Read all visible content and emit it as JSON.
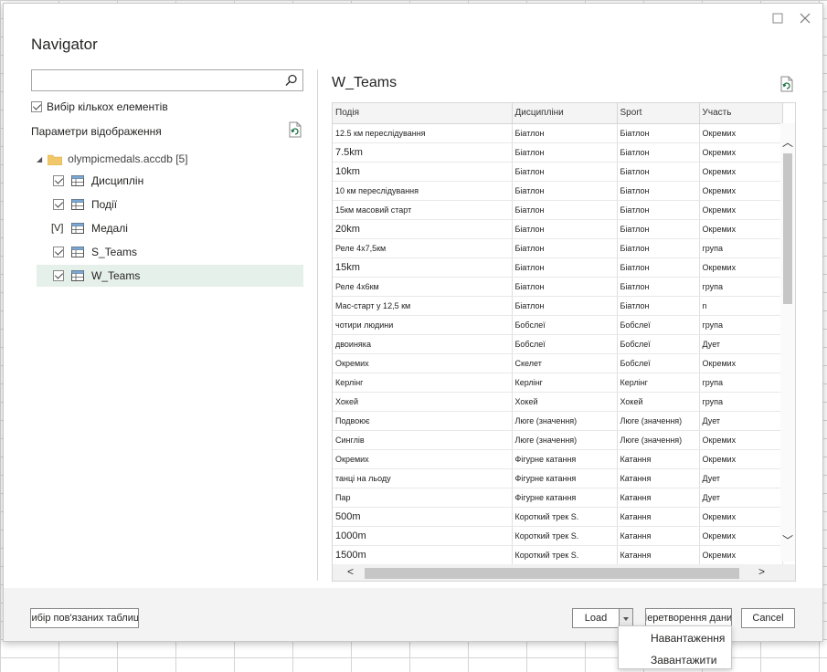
{
  "dialog": {
    "title": "Navigator",
    "window_controls": {
      "maximize_icon": "maximize-icon",
      "close_icon": "close-icon"
    }
  },
  "left_pane": {
    "search": {
      "placeholder": "",
      "value": ""
    },
    "multi_select_label": "Вибір кількох елементів",
    "multi_select_checked": true,
    "display_options_label": "Параметри відображення",
    "tree": {
      "root_label": "olympicmedals.accdb [5]",
      "items": [
        {
          "label": "Дисциплін",
          "checked": true,
          "selected": false
        },
        {
          "label": "Події",
          "checked": true,
          "selected": false
        },
        {
          "label": "Медалі",
          "checked": false,
          "partial_marker": "[V]",
          "selected": false
        },
        {
          "label": "S_Teams",
          "checked": true,
          "selected": false
        },
        {
          "label": "W_Teams",
          "checked": true,
          "selected": true
        }
      ]
    }
  },
  "preview": {
    "title": "W_Teams",
    "columns": [
      "Подія",
      "Дисципліни",
      "Sport",
      "Участь"
    ],
    "rows": [
      [
        "12.5 км переслідування",
        "Біатлон",
        "Біатлон",
        "Окремих"
      ],
      [
        "7.5km",
        "Біатлон",
        "Біатлон",
        "Окремих"
      ],
      [
        "10km",
        "Біатлон",
        "Біатлон",
        "Окремих"
      ],
      [
        "10 км переслідування",
        "Біатлон",
        "Біатлон",
        "Окремих"
      ],
      [
        "15км масовий старт",
        "Біатлон",
        "Біатлон",
        "Окремих"
      ],
      [
        "20km",
        "Біатлон",
        "Біатлон",
        "Окремих"
      ],
      [
        "Реле 4x7,5км",
        "Біатлон",
        "Біатлон",
        "група"
      ],
      [
        "15km",
        "Біатлон",
        "Біатлон",
        "Окремих"
      ],
      [
        "Реле 4x6км",
        "Біатлон",
        "Біатлон",
        "група"
      ],
      [
        "Мас-старт у 12,5 км",
        "Біатлон",
        "Біатлон",
        "n"
      ],
      [
        "чотири людини",
        "Бобслеї",
        "Бобслеї",
        "група"
      ],
      [
        "двоиняка",
        "Бобслеї",
        "Бобслеї",
        "Дует"
      ],
      [
        "Окремих",
        "Скелет",
        "Бобслеї",
        "Окремих"
      ],
      [
        "Керлінг",
        "Керлінг",
        "Керлінг",
        "група"
      ],
      [
        "Хокей",
        "Хокей",
        "Хокей",
        "група"
      ],
      [
        "Подвоює",
        "Люге (значення)",
        "Люге (значення)",
        "Дует"
      ],
      [
        "Синглів",
        "Люге (значення)",
        "Люге (значення)",
        "Окремих"
      ],
      [
        "Окремих",
        "Фігурне катання",
        "Катання",
        "Окремих"
      ],
      [
        "танці на льоду",
        "Фігурне катання",
        "Катання",
        "Дует"
      ],
      [
        "Пар",
        "Фігурне катання",
        "Катання",
        "Дует"
      ],
      [
        "500m",
        "Короткий трек S.",
        "Катання",
        "Окремих"
      ],
      [
        "1000m",
        "Короткий трек S.",
        "Катання",
        "Окремих"
      ],
      [
        "1500m",
        "Короткий трек S.",
        "Катання",
        "Окремих"
      ]
    ]
  },
  "footer": {
    "related_tables_button": "Вибір пов'язаних таблиць",
    "load_button": "Load",
    "transform_button": "Перетворення даних",
    "cancel_button": "Cancel"
  },
  "load_menu": {
    "items": [
      "Навантаження",
      "Завантажити до..."
    ]
  }
}
